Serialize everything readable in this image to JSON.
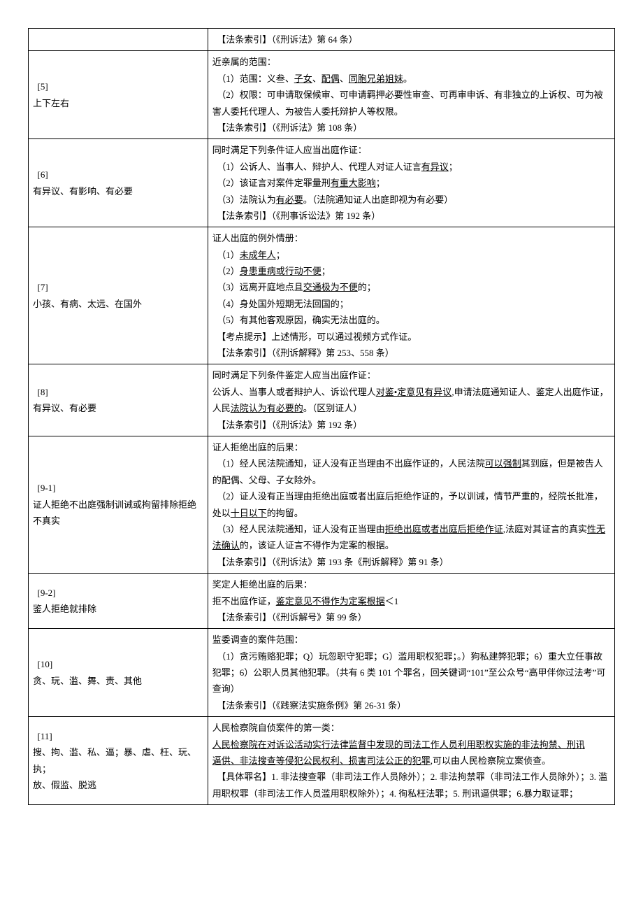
{
  "rows": [
    {
      "left": "",
      "right": "　【法条索引】（《刑诉法》第 64 条）"
    },
    {
      "left_idx": "[5]",
      "left_sub": "上下左右",
      "right": "近亲属的范围：\n　（1）范围：义叁、<u>子女</u>、<u>配偶</u>、<u>同胞兄弟姐妹</u>。\n　（2）权限：可申请取保候审、可申请羁押必要性审查、可再审申诉、有非独立的上诉权、可为被害人委托代理人、为被告人委托辩护人等权限。\n　【法条索引】（《刑诉法》第 108 条）"
    },
    {
      "left_idx": "[6]",
      "left_sub": "有异议、有影响、有必要",
      "right": "同时满足下列条件证人应当出庭作证：\n　（1）公诉人、当事人、辩护人、代理人对证人证言<u>有异议</u>；\n　（2）该证言对案件定罪量刑<u>有重大影响</u>；\n　（3）法院认为<u>有必要</u>。（法院通知证人出庭即视为有必要）\n　【法条索引】（《刑事诉讼法》第 192 条）"
    },
    {
      "left_idx": "[7]",
      "left_sub": "小孩、有病、太远、在国外",
      "right": "证人出庭的例外情册：\n　（1）<u>未成年人</u>；\n　（2）<u>身患重病或行动不便</u>；\n　（3）远离开庭地点且<u>交通极为不便</u>的；\n　（4）身处国外短期无法回国的；\n　（5）有其他客观原因，确实无法出庭的。\n　【考点提示】上述情形，可以通过视频方式作证。\n　【法条索引】（《刑诉解释》第 253、558 条）"
    },
    {
      "left_idx": "[8]",
      "left_sub": "有异议、有必要",
      "right": "同时满足下列条件鉴定人应当出庭作证：\n公诉人、当事人或者辩护人、诉讼代理人<u>对鉴•定意见有异议</u>,申请法庭通知证人、鉴定人出庭作证，人民<u>法院认为有必要的</u>。（区别证人）\n　【法条索引】（《刑诉法》第 192 条）"
    },
    {
      "left_idx": "[9-1]",
      "left_sub": "证人拒绝不出庭强制训诫或拘留排除拒绝不真实",
      "right": "证人拒绝出庭的后果：\n　（1）经人民法院通知，证人没有正当理由不出庭作证的，人民法院<u>可以强制</u>其到庭，但是被告人的配偶、父母、子女除外。\n　（2）证人没有正当理由拒绝出庭或者出庭后拒绝作证的，予以训诫，情节严重的，经院长批准，处以<u>十日以下</u>的拘留。\n　（3）经人民法院通知，证人没有正当理由<u>拒绝出庭或者出庭后拒绝作证</u>,法庭对其证言的真实<u>性无法确认</u>的，该证人证言不得作为定案的根据。\n　【法条索引】（《刑诉法》第 193 条《刑诉解释》第 91 条）"
    },
    {
      "left_idx": "[9-2]",
      "left_sub": "鉴人拒绝就排除",
      "right": "奖定人拒绝出庭的后果：\n拒不出庭作证，<u>鉴定意见不得作为定案根据</u>＜1\n　【法条索引】（《刑诉解号》第 99 条）"
    },
    {
      "left_idx": "[10]",
      "left_sub": "贪、玩、滥、舞、责、其他",
      "right": "监委调查的案件范围：\n　（1）贪污贿赂犯罪；Q）玩忽职守犯罪；G）滥用职权犯罪；。）狗私建弊犯罪；6）重大立任事故犯罪；6）公职人员其他犯罪。（共有 6 类 101 个罪名，回关键词“101”至公众号“高甲伴你过法考”可查询）\n　【法条索引】（《践察法实施条例》第 26-31 条）"
    },
    {
      "left_idx": "[11]",
      "left_sub": "搜、拘、滥、私、逼；暴、虐、枉、玩、执；\n放、假监、脱逃",
      "right": "人民检察院自侦案件的第一类：\n<u>人民检察院在对诉讼活动实行法律监督中发现的司法工作人员利用职权实施的非法拘禁、刑讯</u>\n<u>逼供、非法搜查等侵犯公民权利、损害司法公正的犯罪</u>,可以由人民检察院立案侦查。\n　【具体罪名】1. 非法搜查罪（非司法工作人员除外）；2. 非法拘禁罪（非司法工作人员除外）；3. 滥用职权罪（非司法工作人员滥用职权除外）；4. 徇私枉法罪；5. 刑讯逼供罪；6.暴力取证罪；"
    }
  ]
}
